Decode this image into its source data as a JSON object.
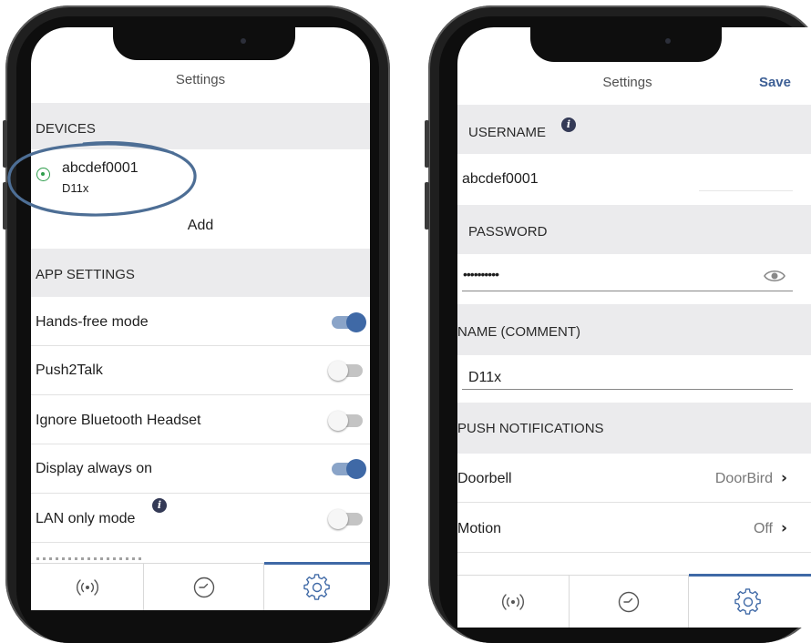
{
  "left_screen": {
    "title": "Settings",
    "devices_header": "DEVICES",
    "device": {
      "name": "abcdef0001",
      "model": "D11x",
      "selected": true
    },
    "add_label": "Add",
    "app_settings_header": "APP SETTINGS",
    "settings": [
      {
        "label": "Hands-free mode",
        "on": true
      },
      {
        "label": "Push2Talk",
        "on": false
      },
      {
        "label": "Ignore Bluetooth Headset",
        "on": false
      },
      {
        "label": "Display always on",
        "on": true
      },
      {
        "label": "LAN only mode",
        "on": false,
        "info": true
      }
    ],
    "tabs": [
      "live-icon",
      "history-icon",
      "settings-icon"
    ],
    "active_tab": "settings-icon"
  },
  "right_screen": {
    "title": "Settings",
    "save_label": "Save",
    "username_header": "USERNAME",
    "username_value": "abcdef0001",
    "password_header": "PASSWORD",
    "password_value": "••••••••••",
    "name_header": "NAME (COMMENT)",
    "name_value": "D11x",
    "push_header": "PUSH NOTIFICATIONS",
    "push_rows": [
      {
        "label": "Doorbell",
        "value": "DoorBird"
      },
      {
        "label": "Motion",
        "value": "Off"
      }
    ],
    "tabs": [
      "live-icon",
      "history-icon",
      "settings-icon"
    ],
    "active_tab": "settings-icon"
  },
  "colors": {
    "accent": "#3f69a6",
    "accent_light": "#8aa4c8",
    "section_bg": "#ebebed",
    "annotation": "#4d6e95",
    "selected_green": "#2e9d4b",
    "save_blue": "#3d5f95"
  }
}
